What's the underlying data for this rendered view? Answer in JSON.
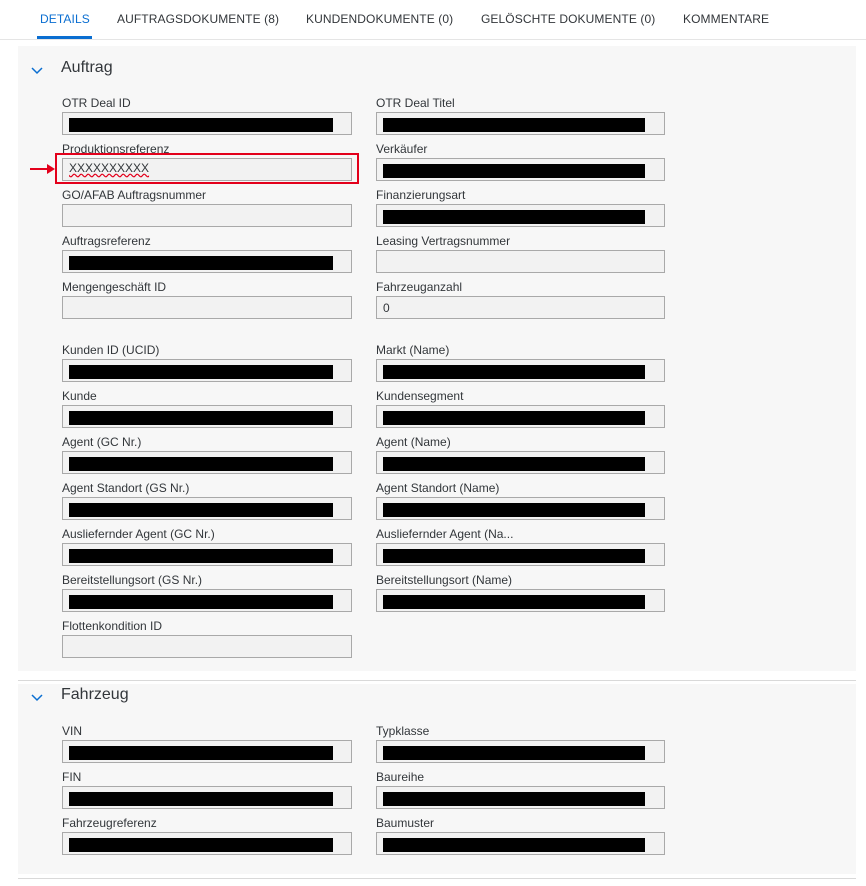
{
  "tabs": [
    {
      "label": "DETAILS",
      "active": true
    },
    {
      "label": "AUFTRAGSDOKUMENTE (8)",
      "active": false
    },
    {
      "label": "KUNDENDOKUMENTE (0)",
      "active": false
    },
    {
      "label": "GELÖSCHTE DOKUMENTE (0)",
      "active": false
    },
    {
      "label": "KOMMENTARE",
      "active": false
    }
  ],
  "colors": {
    "accent": "#0a6ed1",
    "highlight": "#e3001b",
    "redaction": "#000000"
  },
  "sections": {
    "auftrag": {
      "title": "Auftrag",
      "icon": "chevron-down-icon",
      "fields": {
        "otr_deal_id": {
          "label": "OTR Deal ID",
          "value": "",
          "redacted": true
        },
        "otr_deal_titel": {
          "label": "OTR Deal Titel",
          "value": "",
          "redacted": true
        },
        "produktionsreferenz": {
          "label": "Produktionsreferenz",
          "value": "XXXXXXXXXX",
          "redacted": false
        },
        "verkaeufer": {
          "label": "Verkäufer",
          "value": "",
          "redacted": true
        },
        "go_afab": {
          "label": "GO/AFAB Auftragsnummer",
          "value": ""
        },
        "finanzierungsart": {
          "label": "Finanzierungsart",
          "value": "",
          "redacted": true
        },
        "auftragsreferenz": {
          "label": "Auftragsreferenz",
          "value": "",
          "redacted": true
        },
        "leasing_vertragsnummer": {
          "label": "Leasing Vertragsnummer",
          "value": ""
        },
        "mengengeschaeft_id": {
          "label": "Mengengeschäft ID",
          "value": ""
        },
        "fahrzeuganzahl": {
          "label": "Fahrzeuganzahl",
          "value": "0"
        },
        "kunden_id": {
          "label": "Kunden ID (UCID)",
          "value": "",
          "redacted": true
        },
        "markt_name": {
          "label": "Markt (Name)",
          "value": "",
          "redacted": true
        },
        "kunde": {
          "label": "Kunde",
          "value": "",
          "redacted": true
        },
        "kundensegment": {
          "label": "Kundensegment",
          "value": "",
          "redacted": true
        },
        "agent_gc": {
          "label": "Agent (GC Nr.)",
          "value": "",
          "redacted": true
        },
        "agent_name": {
          "label": "Agent (Name)",
          "value": "",
          "redacted": true
        },
        "agent_standort_gs": {
          "label": "Agent Standort (GS Nr.)",
          "value": "",
          "redacted": true
        },
        "agent_standort_name": {
          "label": "Agent Standort (Name)",
          "value": "",
          "redacted": true
        },
        "ausliefernder_agent_gc": {
          "label": "Ausliefernder Agent (GC Nr.)",
          "value": "",
          "redacted": true
        },
        "ausliefernder_agent_name": {
          "label": "Ausliefernder Agent (Na...",
          "value": "",
          "redacted": true
        },
        "bereitstellungsort_gs": {
          "label": "Bereitstellungsort (GS Nr.)",
          "value": "",
          "redacted": true
        },
        "bereitstellungsort_name": {
          "label": "Bereitstellungsort (Name)",
          "value": "",
          "redacted": true
        },
        "flottenkondition_id": {
          "label": "Flottenkondition ID",
          "value": ""
        }
      }
    },
    "fahrzeug": {
      "title": "Fahrzeug",
      "icon": "chevron-down-icon",
      "fields": {
        "vin": {
          "label": "VIN",
          "value": "",
          "redacted": true
        },
        "typklasse": {
          "label": "Typklasse",
          "value": "",
          "redacted": true
        },
        "fin": {
          "label": "FIN",
          "value": "",
          "redacted": true
        },
        "baureihe": {
          "label": "Baureihe",
          "value": "",
          "redacted": true
        },
        "fahrzeugreferenz": {
          "label": "Fahrzeugreferenz",
          "value": "",
          "redacted": true
        },
        "baumuster": {
          "label": "Baumuster",
          "value": "",
          "redacted": true
        }
      }
    }
  },
  "annotation": {
    "icon": "red-arrow-icon"
  }
}
